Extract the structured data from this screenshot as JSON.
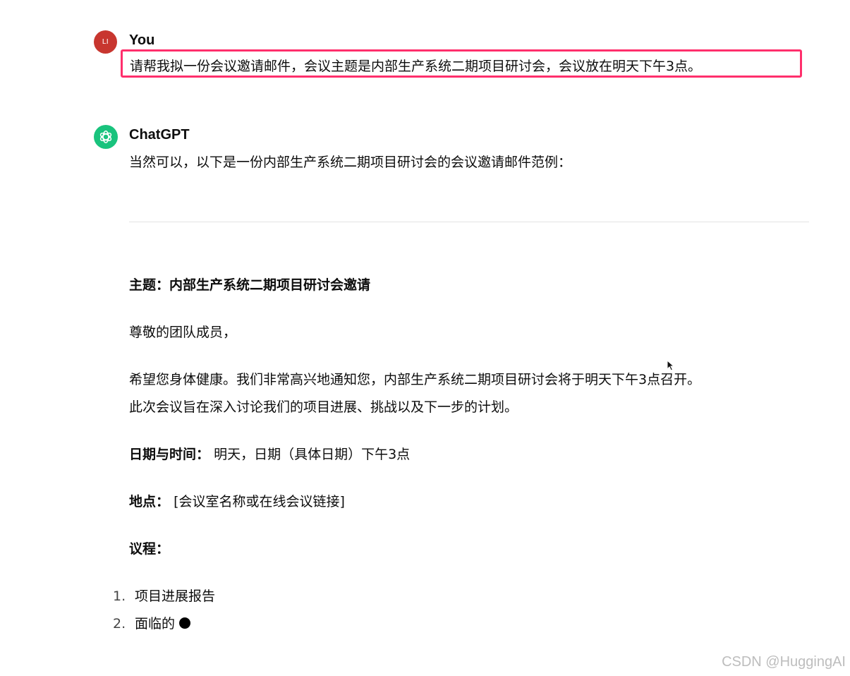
{
  "conversation": {
    "user": {
      "avatar_initials": "LI",
      "avatar_color": "#c8362f",
      "author": "You",
      "message": "请帮我拟一份会议邀请邮件，会议主题是内部生产系统二期项目研讨会，会议放在明天下午3点。",
      "highlight_color": "#ff2f6c"
    },
    "assistant": {
      "author": "ChatGPT",
      "avatar_icon": "openai-logo-icon",
      "avatar_color": "#19c37d",
      "intro": "当然可以，以下是一份内部生产系统二期项目研讨会的会议邀请邮件范例：",
      "email": {
        "subject_label": "主题：",
        "subject_value": "内部生产系统二期项目研讨会邀请",
        "greeting": "尊敬的团队成员，",
        "body_line1": "希望您身体健康。我们非常高兴地通知您，内部生产系统二期项目研讨会将于明天下午3点召开。",
        "body_line2": "此次会议旨在深入讨论我们的项目进展、挑战以及下一步的计划。",
        "datetime_label": "日期与时间：",
        "datetime_value": "明天，日期（具体日期）下午3点",
        "location_label": "地点：",
        "location_value": "[会议室名称或在线会议链接]",
        "agenda_label": "议程：",
        "agenda": [
          {
            "num": "1.",
            "text": "项目进展报告"
          },
          {
            "num": "2.",
            "text": "面临的"
          }
        ]
      }
    }
  },
  "watermark": "CSDN @HuggingAI"
}
